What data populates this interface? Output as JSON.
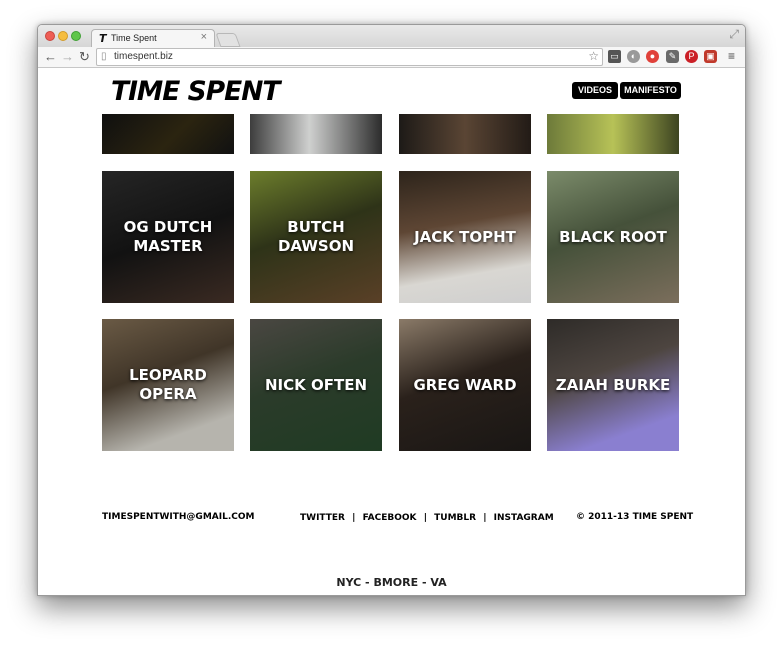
{
  "browser": {
    "tab_title": "Time Spent",
    "tab_favicon": "T",
    "tab_close": "×",
    "url": "timespent.biz",
    "icons": {
      "back": "back-arrow-icon",
      "forward": "forward-arrow-icon",
      "reload": "reload-icon",
      "star": "bookmark-star-icon",
      "menu": "menu-icon"
    }
  },
  "site": {
    "logo": "TIME SPENT",
    "nav": {
      "videos": "VIDEOS",
      "manifesto": "MANIFESTO"
    },
    "grid": {
      "row1_partial": [
        "",
        "",
        "",
        ""
      ],
      "row2": [
        "OG DUTCH MASTER",
        "BUTCH DAWSON",
        "JACK TOPHT",
        "BLACK ROOT"
      ],
      "row3": [
        "LEOPARD OPERA",
        "NICK OFTEN",
        "GREG WARD",
        "ZAIAH BURKE"
      ]
    },
    "footer": {
      "email": "TIMESPENTWITH@GMAIL.COM",
      "links": [
        "TWITTER",
        "FACEBOOK",
        "TUMBLR",
        "INSTAGRAM"
      ],
      "separator": "|",
      "copyright": "© 2011-13 TIME SPENT",
      "locations": "NYC - BMORE - VA"
    }
  },
  "colors": {
    "nav_button_bg": "#000000",
    "text": "#000000"
  }
}
